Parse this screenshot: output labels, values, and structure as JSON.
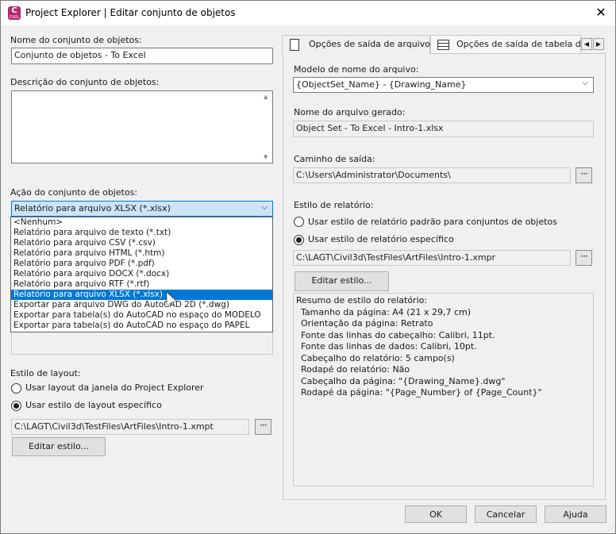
{
  "window": {
    "title": "Project Explorer | Editar conjunto de objetos",
    "close_glyph": "✕",
    "icon_letter": "C",
    "icon_sub": "CIVIL"
  },
  "left": {
    "name_label": "Nome do conjunto de objetos:",
    "name_value": "Conjunto de objetos - To Excel",
    "description_label": "Descrição do conjunto de objetos:",
    "description_value": "",
    "action_label": "Ação do conjunto de objetos:",
    "action_selected": "Relatório para arquivo XLSX (*.xlsx)",
    "action_options": [
      "<Nenhum>",
      "Relatório para arquivo de texto (*.txt)",
      "Relatório para arquivo CSV (*.csv)",
      "Relatório para arquivo HTML (*.htm)",
      "Relatório para arquivo PDF (*.pdf)",
      "Relatório para arquivo DOCX (*.docx)",
      "Relatório para arquivo RTF (*.rtf)",
      "Relatório para arquivo XLSX (*.xlsx)",
      "Exportar para arquivo DWG do AutoCAD 2D (*.dwg)",
      "Exportar para tabela(s) do AutoCAD no espaço do MODELO",
      "Exportar para tabela(s) do AutoCAD no espaço do PAPEL"
    ],
    "highlighted_option_index": 7,
    "layout_label": "Estilo de layout:",
    "layout_radio_1": "Usar layout da janela do Project Explorer",
    "layout_radio_2": "Usar estilo de layout específico",
    "layout_selected_radio": 2,
    "layout_path": "C:\\LAGT\\Civil3d\\TestFiles\\ArtFiles\\Intro-1.xmpt",
    "edit_style_button": "Editar estilo...",
    "browse_glyph": "···"
  },
  "tabs": [
    {
      "label": "Opções de saída de arquivo",
      "active": true,
      "icon": "document-icon"
    },
    {
      "label": "Opções de saída de tabela do",
      "active": false,
      "icon": "table-icon"
    }
  ],
  "tab_scroll": {
    "left": "◀",
    "right": "▶"
  },
  "right": {
    "filename_template_label": "Modelo de nome do arquivo:",
    "filename_template_value": "{ObjectSet_Name} - {Drawing_Name}",
    "generated_name_label": "Nome do arquivo gerado:",
    "generated_name_value": "Object Set - To Excel - Intro-1.xlsx",
    "output_path_label": "Caminho de saída:",
    "output_path_value": "C:\\Users\\Administrator\\Documents\\",
    "report_style_label": "Estilo de relatório:",
    "report_radio_1": "Usar estilo de relatório padrão para conjuntos de objetos",
    "report_radio_2": "Usar estilo de relatório específico",
    "report_selected_radio": 2,
    "report_style_path": "C:\\LAGT\\Civil3d\\TestFiles\\ArtFiles\\Intro-1.xmpr",
    "edit_style_button": "Editar estilo...",
    "browse_glyph": "···",
    "summary_title": "Resumo de estilo do relatório:",
    "summary_lines": [
      "Tamanho da página: A4 (21 x 29,7 cm)",
      "Orientação da página: Retrato",
      "Fonte das linhas do cabeçalho: Calibri, 11pt.",
      "Fonte das linhas de dados: Calibri, 10pt.",
      "Cabeçalho do relatório: 5 campo(s)",
      "Rodapé do relatório: Não",
      "Cabeçalho da página: \"{Drawing_Name}.dwg\"",
      "Rodapé da página: \"{Page_Number} of {Page_Count}\""
    ]
  },
  "footer": {
    "ok": "OK",
    "cancel": "Cancelar",
    "help": "Ajuda"
  },
  "colors": {
    "selection": "#0078d7",
    "combo_highlight": "#cce4f7",
    "app_icon": "#b02a6b"
  }
}
